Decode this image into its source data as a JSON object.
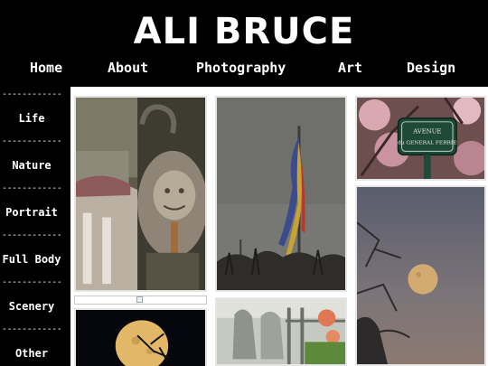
{
  "site": {
    "title": "ALI BRUCE"
  },
  "topnav": {
    "items": [
      "Home",
      "About",
      "Photography",
      "Art",
      "Design"
    ]
  },
  "sidebar": {
    "separator": "------------",
    "items": [
      "Life",
      "Nature",
      "Portrait",
      "Full Body",
      "Scenery",
      "Other"
    ]
  },
  "gallery": {
    "sign_line1": "AVENUE",
    "sign_line2": "du GENERAL FERRIE"
  },
  "colors": {
    "background": "#000000",
    "text": "#ffffff",
    "page": "#ffffff"
  }
}
